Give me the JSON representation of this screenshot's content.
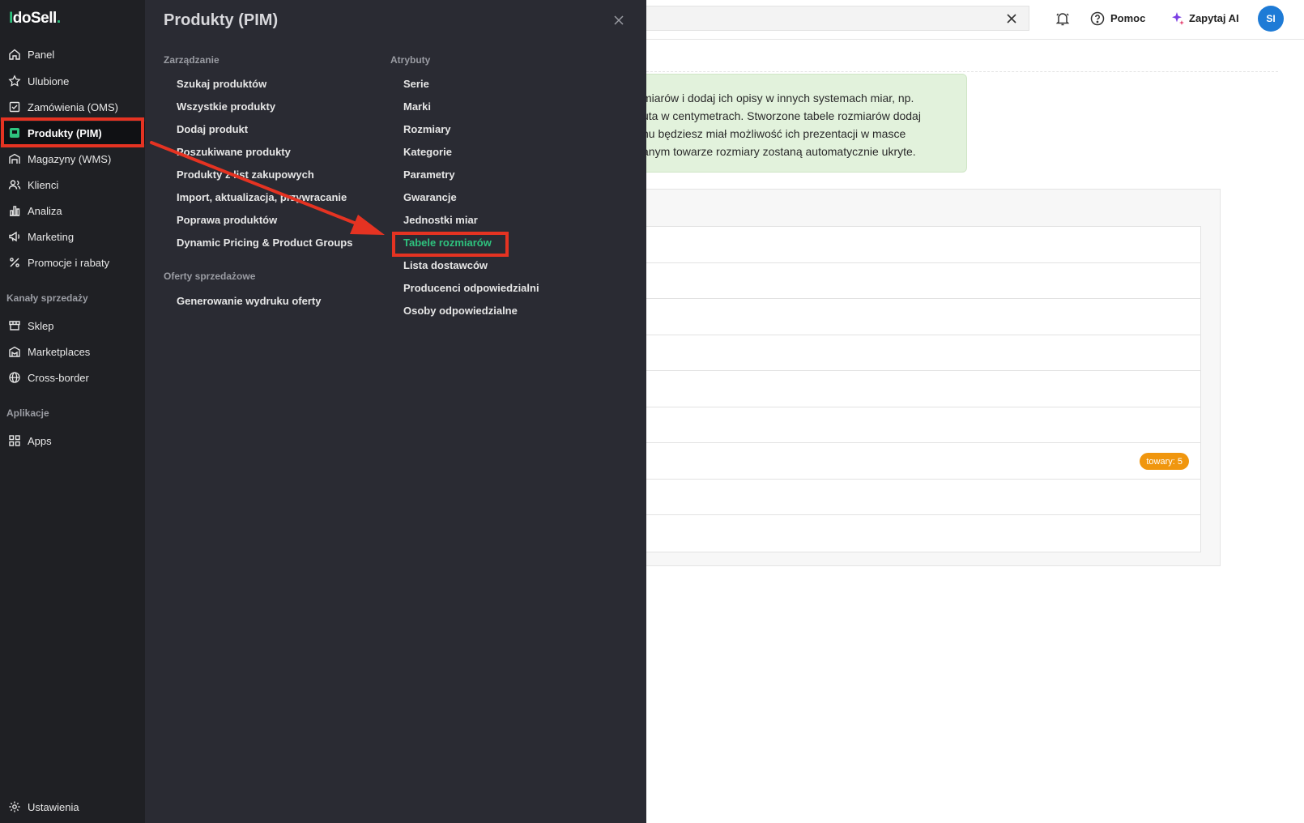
{
  "logo": {
    "part1": "I",
    "part2": "do",
    "part3": "Sell",
    "dot": "."
  },
  "sidebar": {
    "items": [
      {
        "label": "Panel",
        "icon": "home-icon"
      },
      {
        "label": "Ulubione",
        "icon": "star-icon"
      },
      {
        "label": "Zamówienia (OMS)",
        "icon": "checklist-icon"
      },
      {
        "label": "Produkty (PIM)",
        "icon": "product-icon",
        "active": true
      },
      {
        "label": "Magazyny (WMS)",
        "icon": "warehouse-icon"
      },
      {
        "label": "Klienci",
        "icon": "users-icon"
      },
      {
        "label": "Analiza",
        "icon": "chart-icon"
      },
      {
        "label": "Marketing",
        "icon": "megaphone-icon"
      },
      {
        "label": "Promocje i rabaty",
        "icon": "percent-icon"
      }
    ],
    "section_sales": "Kanały sprzedaży",
    "sales_items": [
      {
        "label": "Sklep",
        "icon": "store-icon"
      },
      {
        "label": "Marketplaces",
        "icon": "marketplace-icon"
      },
      {
        "label": "Cross-border",
        "icon": "globe-icon"
      }
    ],
    "section_apps": "Aplikacje",
    "apps_items": [
      {
        "label": "Apps",
        "icon": "apps-grid-icon"
      }
    ],
    "settings": {
      "label": "Ustawienia",
      "icon": "gear-icon"
    }
  },
  "flyout": {
    "title": "Produkty (PIM)",
    "management": {
      "heading": "Zarządzanie",
      "links": [
        "Szukaj produktów",
        "Wszystkie produkty",
        "Dodaj produkt",
        "Poszukiwane produkty",
        "Produkty z list zakupowych",
        "Import, aktualizacja, przywracanie",
        "Poprawa produktów",
        "Dynamic Pricing & Product Groups"
      ]
    },
    "offers": {
      "heading": "Oferty sprzedażowe",
      "links": [
        "Generowanie wydruku oferty"
      ]
    },
    "attributes": {
      "heading": "Atrybuty",
      "links": [
        "Serie",
        "Marki",
        "Rozmiary",
        "Kategorie",
        "Parametry",
        "Gwarancje",
        "Jednostki miar",
        "Tabele rozmiarów",
        "Lista dostawców",
        "Producenci odpowiedzialni",
        "Osoby odpowiedzialne"
      ],
      "current_index": 7
    }
  },
  "topbar": {
    "search_value": "",
    "help_label": "Pomoc",
    "ai_label": "Zapytaj AI",
    "avatar_initials": "SI"
  },
  "info": {
    "lines": [
      "miarów i dodaj ich opisy w innych systemach miar, np.",
      "uta w centymetrach. Stworzone tabele rozmiarów dodaj",
      "nu będziesz miał możliwość ich prezentacji w masce",
      "anym towarze rozmiary zostaną automatycznie ukryte."
    ]
  },
  "table": {
    "row_count": 9,
    "badge_row": 6,
    "badge_label": "towary: 5"
  },
  "colors": {
    "accent": "#2ec27e",
    "highlight": "#e53322",
    "badge": "#f0960e",
    "avatar": "#1e7bd6"
  }
}
